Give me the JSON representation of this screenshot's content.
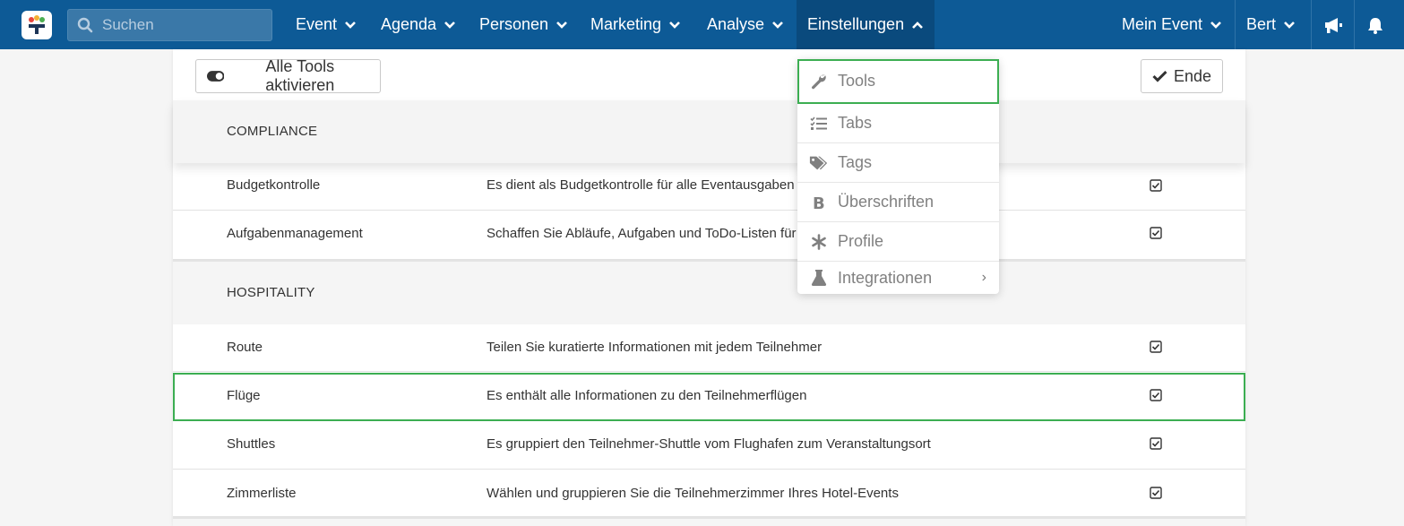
{
  "search": {
    "placeholder": "Suchen"
  },
  "nav": {
    "event": "Event",
    "agenda": "Agenda",
    "personen": "Personen",
    "marketing": "Marketing",
    "analyse": "Analyse",
    "einstellungen": "Einstellungen",
    "mein_event": "Mein Event",
    "user": "Bert"
  },
  "toolbar": {
    "toggle_label": "Alle Tools aktivieren",
    "end_label": "Ende"
  },
  "sections": {
    "compliance": "COMPLIANCE",
    "hospitality": "HOSPITALITY"
  },
  "rows": [
    {
      "name": "Budgetkontrolle",
      "desc": "Es dient als Budgetkontrolle für alle Eventausgaben",
      "checked": true
    },
    {
      "name": "Aufgabenmanagement",
      "desc": "Schaffen Sie Abläufe, Aufgaben und ToDo-Listen für d",
      "checked": true
    },
    {
      "name": "Route",
      "desc": "Teilen Sie kuratierte Informationen mit jedem Teilnehmer",
      "checked": true
    },
    {
      "name": "Flüge",
      "desc": "Es enthält alle Informationen zu den Teilnehmerflügen",
      "checked": true
    },
    {
      "name": "Shuttles",
      "desc": "Es gruppiert den Teilnehmer-Shuttle vom Flughafen zum Veranstaltungsort",
      "checked": true
    },
    {
      "name": "Zimmerliste",
      "desc": "Wählen und gruppieren Sie die Teilnehmerzimmer Ihres Hotel-Events",
      "checked": true
    }
  ],
  "dropdown": {
    "items": [
      {
        "label": "Tools",
        "icon": "wrench-icon"
      },
      {
        "label": "Tabs",
        "icon": "list-check-icon"
      },
      {
        "label": "Tags",
        "icon": "tags-icon"
      },
      {
        "label": "Überschriften",
        "icon": "bold-icon"
      },
      {
        "label": "Profile",
        "icon": "asterisk-icon"
      },
      {
        "label": "Integrationen",
        "icon": "flask-icon",
        "submenu_arrow": "›"
      }
    ]
  },
  "colors": {
    "topbar": "#0d5a96",
    "highlight": "#3cae52"
  }
}
